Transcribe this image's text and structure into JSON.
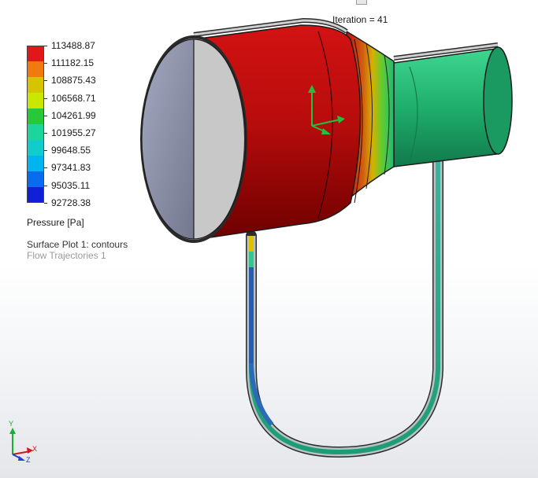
{
  "iteration_label": "Iteration = 41",
  "legend": {
    "title": "Pressure [Pa]",
    "values": [
      "113488.87",
      "111182.15",
      "108875.43",
      "106568.71",
      "104261.99",
      "101955.27",
      "99648.55",
      "97341.83",
      "95035.11",
      "92728.38"
    ],
    "colors": [
      "#e01818",
      "#f07a10",
      "#d6c400",
      "#c8e800",
      "#28c83a",
      "#1dd49a",
      "#10cccc",
      "#00b4f0",
      "#0a6af0",
      "#1020d8"
    ]
  },
  "plot_list": {
    "surface_plot": "Surface Plot 1: contours",
    "flow_trajectories": "Flow Trajectories 1"
  },
  "triad": {
    "x": "X",
    "y": "Y",
    "z": "Z"
  },
  "colors": {
    "body_red": "#c81010",
    "body_dark_red": "#7a0000",
    "outlet_green": "#22b878",
    "end_cap_gray": "#8a8ea8",
    "tube_blue": "#2a5bb0"
  }
}
